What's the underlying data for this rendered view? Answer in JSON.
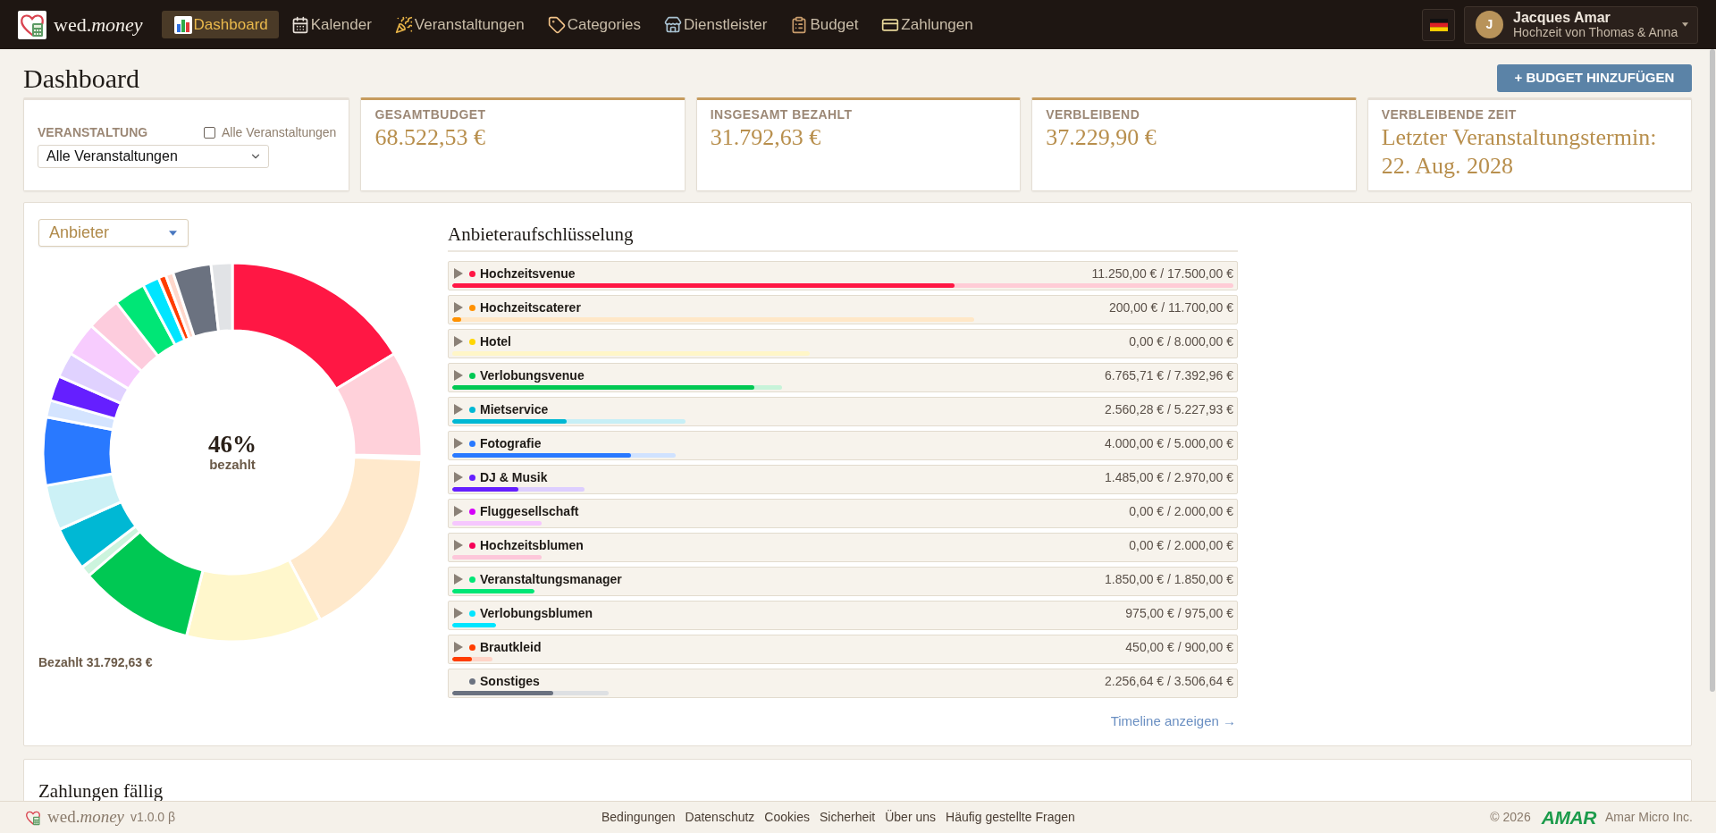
{
  "nav": {
    "brand": "wed.*money*",
    "items": [
      {
        "label": "Dashboard",
        "selected": true
      },
      {
        "label": "Kalender",
        "selected": false
      },
      {
        "label": "Veranstaltungen",
        "selected": false
      },
      {
        "label": "Categories",
        "selected": false
      },
      {
        "label": "Dienstleister",
        "selected": false
      },
      {
        "label": "Budget",
        "selected": false
      },
      {
        "label": "Zahlungen",
        "selected": false
      }
    ],
    "user": {
      "initial": "J",
      "name": "Jacques Amar",
      "subtitle": "Hochzeit von Thomas & Anna"
    }
  },
  "header": {
    "title": "Dashboard",
    "add_button": "+ BUDGET HINZUFÜGEN"
  },
  "event_filter": {
    "label": "VERANSTALTUNG",
    "all_toggle": {
      "label": "Alle Veranstaltungen",
      "checked": false
    },
    "select_value": "Alle Veranstaltungen"
  },
  "stat_cards": [
    {
      "kind": "money",
      "label": "GESAMTBUDGET",
      "value": "68.522,53 €"
    },
    {
      "kind": "money",
      "label": "INSGESAMT BEZAHLT",
      "value": "31.792,63 €"
    },
    {
      "kind": "money",
      "label": "VERBLEIBEND",
      "value": "37.229,90 €"
    },
    {
      "kind": "time",
      "label": "VERBLEIBENDE ZEIT",
      "value": "Letzter Veranstaltungstermin: 22. Aug. 2028"
    }
  ],
  "overview": {
    "group_select": "Anbieter",
    "donut": {
      "percent": "46%",
      "caption": "bezahlt"
    },
    "paid_total": "Bezahlt 31.792,63 €",
    "breakdown": {
      "title": "Anbieteraufschlüsselung",
      "rows": [
        {
          "kind": "vendor",
          "expanded": false,
          "color": "#ff1744",
          "name": "Hochzeitsvenue",
          "amount": "11.250,00 € / 17.500,00 €",
          "level": 0.643
        },
        {
          "kind": "vendor",
          "expanded": false,
          "color": "#ff9100",
          "name": "Hochzeitscaterer",
          "amount": "200,00 € / 11.700,00 €",
          "level": 0.017
        },
        {
          "kind": "vendor",
          "expanded": false,
          "color": "#ffd600",
          "name": "Hotel",
          "amount": "0,00 € / 8.000,00 €",
          "level": 0
        },
        {
          "kind": "vendor",
          "expanded": false,
          "color": "#00c853",
          "name": "Verlobungsvenue",
          "amount": "6.765,71 € / 7.392,96 €",
          "level": 0.915
        },
        {
          "kind": "vendor",
          "expanded": false,
          "color": "#00b8d4",
          "name": "Mietservice",
          "amount": "2.560,28 € / 5.227,93 €",
          "level": 0.49
        },
        {
          "kind": "vendor",
          "expanded": false,
          "color": "#2979ff",
          "name": "Fotografie",
          "amount": "4.000,00 € / 5.000,00 €",
          "level": 0.8
        },
        {
          "kind": "vendor",
          "expanded": false,
          "color": "#651fff",
          "name": "DJ & Musik",
          "amount": "1.485,00 € / 2.970,00 €",
          "level": 0.5
        },
        {
          "kind": "vendor",
          "expanded": false,
          "color": "#d500f9",
          "name": "Fluggesellschaft",
          "amount": "0,00 € / 2.000,00 €",
          "level": 0
        },
        {
          "kind": "vendor",
          "expanded": false,
          "color": "#f50057",
          "name": "Hochzeitsblumen",
          "amount": "0,00 € / 2.000,00 €",
          "level": 0
        },
        {
          "kind": "vendor",
          "expanded": false,
          "color": "#00e676",
          "name": "Veranstaltungsmanager",
          "amount": "1.850,00 € / 1.850,00 €",
          "level": 1
        },
        {
          "kind": "vendor",
          "expanded": false,
          "color": "#00e5ff",
          "name": "Verlobungsblumen",
          "amount": "975,00 € / 975,00 €",
          "level": 1
        },
        {
          "kind": "vendor",
          "expanded": false,
          "color": "#ff3d00",
          "name": "Brautkleid",
          "amount": "450,00 € / 900,00 €",
          "level": 0.5
        },
        {
          "kind": "other",
          "color": "#6b7280",
          "name": "Sonstiges",
          "amount": "2.256,64 € / 3.506,64 €",
          "level": 0.644
        }
      ],
      "timeline_link": "Timeline anzeigen →"
    }
  },
  "payments_due": {
    "title": "Zahlungen fällig"
  },
  "footer": {
    "brand": "wed.*money*",
    "version": "v1.0.0 β",
    "links": [
      "Bedingungen",
      "Datenschutz",
      "Cookies",
      "Sicherheit",
      "Über uns",
      "Häufig gestellte Fragen"
    ],
    "copyright": "© 2026",
    "company_logo": "AMAR",
    "company": "Amar Micro Inc."
  }
}
